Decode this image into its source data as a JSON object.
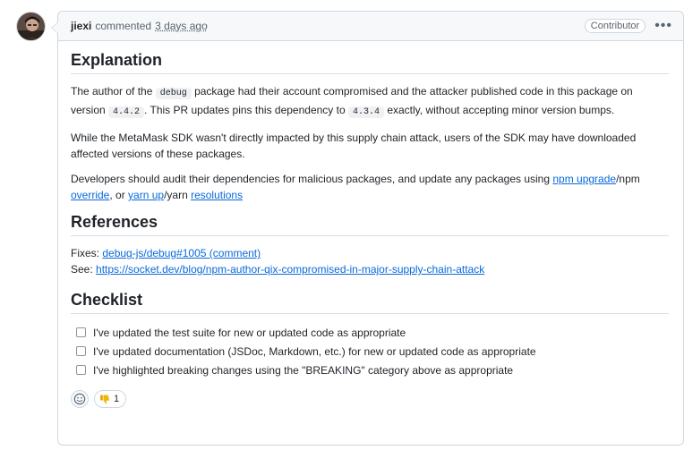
{
  "comment": {
    "author": "jiexi",
    "action": "commented",
    "time": "3 days ago",
    "badge": "Contributor",
    "menu_icon": "kebab-horizontal-icon"
  },
  "explanation": {
    "heading": "Explanation",
    "p1_a": "The author of the ",
    "p1_code1": "debug",
    "p1_b": " package had their account compromised and the attacker published code in this package on version ",
    "p1_code2": "4.4.2",
    "p1_c": ". This PR updates pins this dependency to ",
    "p1_code3": "4.3.4",
    "p1_d": " exactly, without accepting minor version bumps.",
    "p2": "While the MetaMask SDK wasn't directly impacted by this supply chain attack, users of the SDK may have downloaded affected versions of these packages.",
    "p3_a": "Developers should audit their dependencies for malicious packages, and update any packages using ",
    "p3_link1": "npm upgrade",
    "p3_b": "/npm ",
    "p3_link2": "override",
    "p3_c": ", or ",
    "p3_link3": "yarn up",
    "p3_d": "/yarn ",
    "p3_link4": "resolutions"
  },
  "references": {
    "heading": "References",
    "fixes_label": "Fixes: ",
    "fixes_link": "debug-js/debug#1005 (comment)",
    "see_label": "See: ",
    "see_link": "https://socket.dev/blog/npm-author-qix-compromised-in-major-supply-chain-attack"
  },
  "checklist": {
    "heading": "Checklist",
    "items": [
      {
        "label": "I've updated the test suite for new or updated code as appropriate",
        "checked": false
      },
      {
        "label": "I've updated documentation (JSDoc, Markdown, etc.) for new or updated code as appropriate",
        "checked": false
      },
      {
        "label": "I've highlighted breaking changes using the \"BREAKING\" category above as appropriate",
        "checked": false
      }
    ]
  },
  "reactions": {
    "add_icon": "smiley-icon",
    "items": [
      {
        "icon": "thumbs-down-icon",
        "count": "1"
      }
    ]
  },
  "colors": {
    "link": "#0969da",
    "header_bg": "#f6f8fa",
    "border": "#d0d7de"
  }
}
